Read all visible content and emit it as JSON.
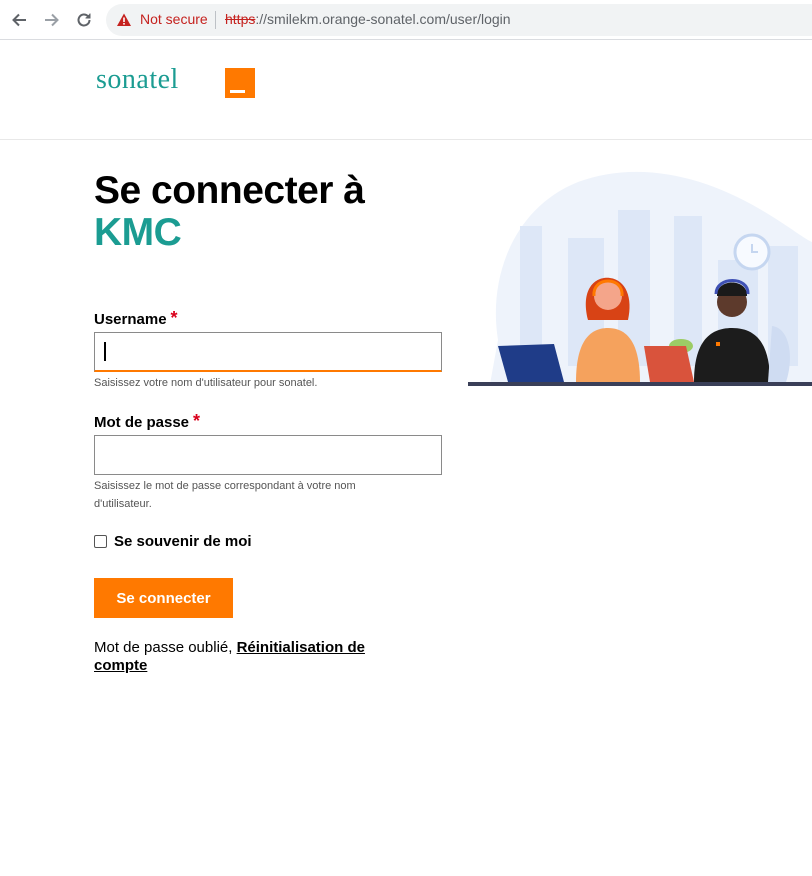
{
  "browser": {
    "security_label": "Not secure",
    "url_scheme": "https",
    "url_rest": "://smilekm.orange-sonatel.com/user/login",
    "icons": [
      "back-arrow-icon",
      "forward-arrow-icon",
      "reload-icon",
      "warning-icon"
    ]
  },
  "header": {
    "logo_text": "sonatel",
    "brand_color": "#ff7900",
    "accent_color": "#1b9c92"
  },
  "page": {
    "title_line1": "Se connecter à",
    "title_line2": "KMC"
  },
  "form": {
    "username_label": "Username",
    "username_required": "*",
    "username_value": "",
    "username_help": "Saisissez votre nom d'utilisateur pour sonatel.",
    "password_label": "Mot de passe",
    "password_required": "*",
    "password_value": "",
    "password_help": "Saisissez le mot de passe correspondant à votre nom d'utilisateur.",
    "remember_label": "Se souvenir de moi",
    "remember_checked": false,
    "submit_label": "Se connecter",
    "forgot_prefix": "Mot de passe oublié,",
    "forgot_link": "Réinitialisation de compte"
  }
}
